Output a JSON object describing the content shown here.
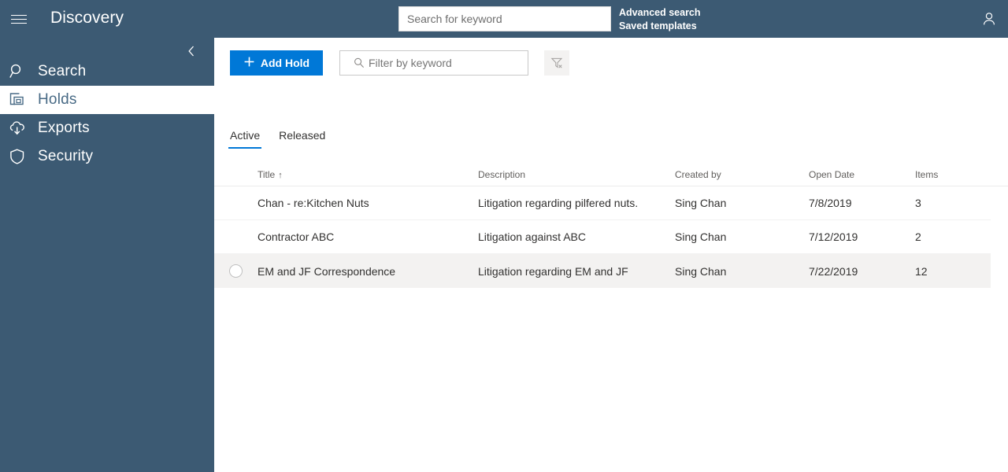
{
  "header": {
    "app_title": "Discovery",
    "menu_icon": "hamburger-icon",
    "search_placeholder": "Search for keyword",
    "search_value": "",
    "advanced_search_label": "Advanced search",
    "saved_templates_label": "Saved templates",
    "account_icon": "person-icon"
  },
  "sidebar": {
    "collapse_icon": "chevron-left-icon",
    "items": [
      {
        "label": "Search",
        "icon": "magnifier-icon",
        "active": false
      },
      {
        "label": "Holds",
        "icon": "copy-holds-icon",
        "active": true
      },
      {
        "label": "Exports",
        "icon": "cloud-download-icon",
        "active": false
      },
      {
        "label": "Security",
        "icon": "shield-icon",
        "active": false
      }
    ]
  },
  "toolbar": {
    "add_hold_label": "Add Hold",
    "add_icon": "plus-icon",
    "filter_placeholder": "Filter by keyword",
    "filter_value": "",
    "filter_search_icon": "search-icon",
    "clear_filter_icon": "filter-clear-icon"
  },
  "tabs": [
    {
      "label": "Active",
      "selected": true
    },
    {
      "label": "Released",
      "selected": false
    }
  ],
  "table": {
    "columns": [
      "Title",
      "Description",
      "Created by",
      "Open Date",
      "Items"
    ],
    "sort_column": "Title",
    "sort_arrow": "↑",
    "rows": [
      {
        "title": "Chan - re:Kitchen Nuts",
        "description": "Litigation regarding pilfered nuts.",
        "created_by": "Sing Chan",
        "open_date": "7/8/2019",
        "items": "3",
        "hovered": false
      },
      {
        "title": "Contractor ABC",
        "description": "Litigation against ABC",
        "created_by": "Sing Chan",
        "open_date": "7/12/2019",
        "items": "2",
        "hovered": false
      },
      {
        "title": "EM and JF Correspondence",
        "description": "Litigation regarding EM and JF",
        "created_by": "Sing Chan",
        "open_date": "7/22/2019",
        "items": "12",
        "hovered": true
      }
    ]
  },
  "colors": {
    "chrome": "#3c5a73",
    "accent": "#0078d7",
    "hover_row": "#f3f2f1",
    "active_nav_text": "#486a85"
  }
}
